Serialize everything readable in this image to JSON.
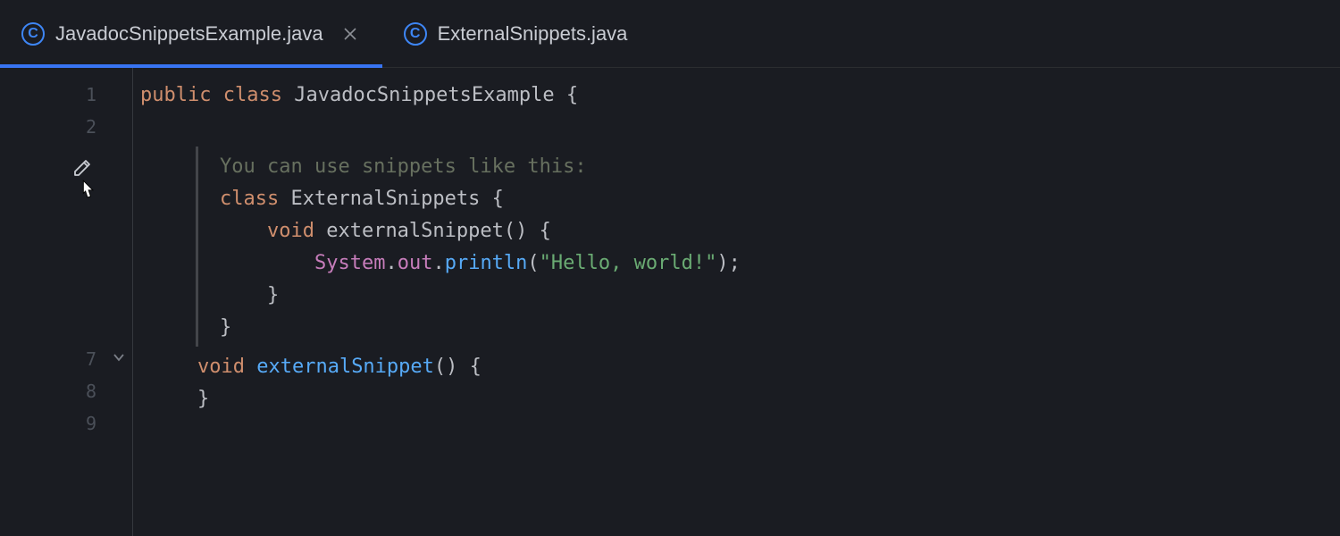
{
  "tabs": [
    {
      "label": "JavadocSnippetsExample.java",
      "active": true,
      "closable": true
    },
    {
      "label": "ExternalSnippets.java",
      "active": false,
      "closable": false
    }
  ],
  "gutter": {
    "lines": [
      "1",
      "2",
      "7",
      "8",
      "9"
    ],
    "fold_at": "7"
  },
  "code": {
    "line1": {
      "kw1": "public",
      "kw2": "class",
      "name": "JavadocSnippetsExample",
      "brace": " {"
    },
    "doc": {
      "intro": "You can use snippets like this:",
      "l1_kw": "class",
      "l1_name": " ExternalSnippets {",
      "l2_kw": "void",
      "l2_name": " externalSnippet() {",
      "l3_obj": "System",
      "l3_dot1": ".",
      "l3_field": "out",
      "l3_dot2": ".",
      "l3_call": "println",
      "l3_open": "(",
      "l3_str": "\"Hello, world!\"",
      "l3_close": ");",
      "l4": "    }",
      "l5": "}"
    },
    "line7": {
      "kw": "void",
      "name": " externalSnippet",
      "sig": "() {"
    },
    "line8": "}",
    "line9": ""
  }
}
